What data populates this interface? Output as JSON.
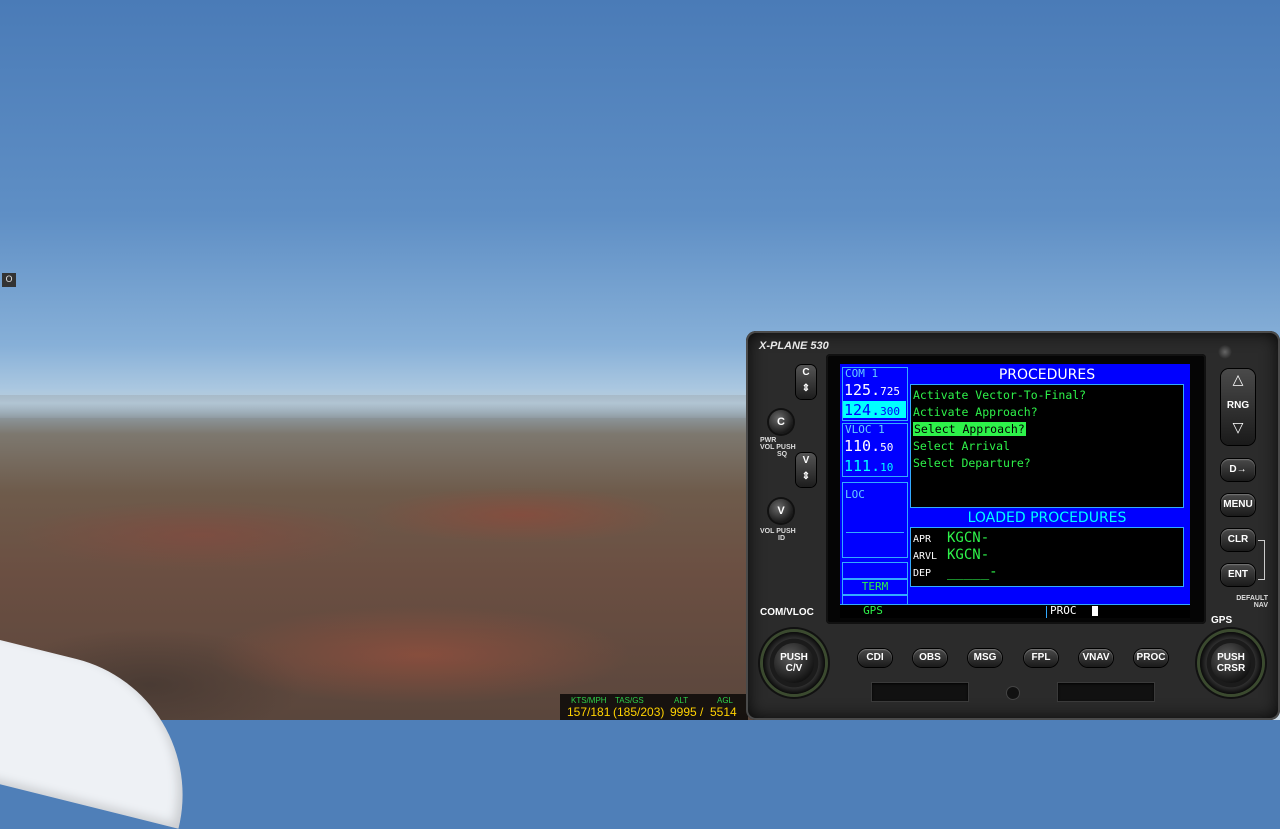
{
  "sim": {
    "side_marker": "O"
  },
  "hud": {
    "labels": [
      "KTS/MPH",
      "TAS/GS",
      "ALT",
      "AGL"
    ],
    "kts_mph": "157/181",
    "tas_gs": "(185/203)",
    "alt": "9995 /",
    "agl": "5514"
  },
  "gps": {
    "brand": "X-PLANE 530",
    "left_labels": {
      "c": "C",
      "v": "V",
      "pwr": "PWR",
      "vol": "VOL",
      "push": "PUSH",
      "sq": "SQ",
      "vol2": "VOL",
      "push2": "PUSH",
      "id": "ID",
      "com_vloc": "COM/VLOC",
      "gps_label": "GPS"
    },
    "com": {
      "label": "COM 1",
      "active_int": "125.",
      "active_dec": "725",
      "standby_int": "124.",
      "standby_dec": "300"
    },
    "vloc": {
      "label": "VLOC 1",
      "active_int": "110.",
      "active_dec": "50",
      "standby_int": "111.",
      "standby_dec": "10"
    },
    "cdi_mode": "LOC",
    "term_label": "TERM",
    "nav_mode": "GPS",
    "page_label": "PROC",
    "procedures": {
      "title": "PROCEDURES",
      "items": [
        "Activate Vector-To-Final?",
        "Activate Approach?",
        "Select Approach?",
        "Select Arrival",
        "Select Departure?"
      ],
      "selected_index": 2
    },
    "loaded": {
      "title": "LOADED PROCEDURES",
      "rows": [
        {
          "label": "APR",
          "value": "KGCN-"
        },
        {
          "label": "ARVL",
          "value": "KGCN-"
        },
        {
          "label": "DEP",
          "value": "_____-"
        }
      ]
    },
    "right_buttons": {
      "rng": "RNG",
      "direct": "D→",
      "menu": "MENU",
      "clr": "CLR",
      "ent": "ENT",
      "default_nav": "DEFAULT NAV"
    },
    "bottom_buttons": [
      "CDI",
      "OBS",
      "MSG",
      "FPL",
      "VNAV",
      "PROC"
    ],
    "left_knob": "PUSH C/V",
    "right_knob": "PUSH CRSR"
  }
}
